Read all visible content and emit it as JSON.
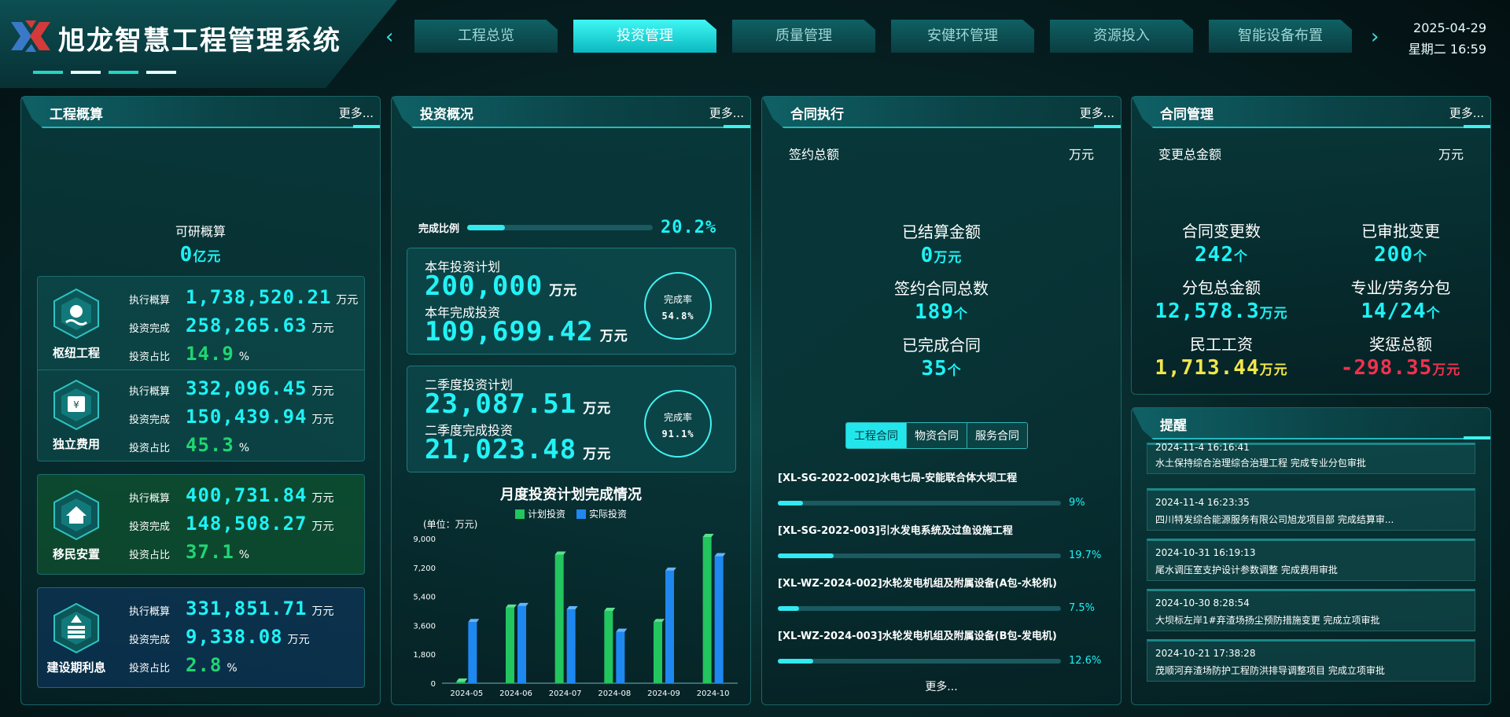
{
  "header": {
    "title": "旭龙智慧工程管理系统",
    "date": "2025-04-29",
    "weekday_time": "星期二  16:59",
    "tabs": [
      {
        "label": "工程总览",
        "active": false
      },
      {
        "label": "投资管理",
        "active": true
      },
      {
        "label": "质量管理",
        "active": false
      },
      {
        "label": "安健环管理",
        "active": false
      },
      {
        "label": "资源投入",
        "active": false
      },
      {
        "label": "智能设备布置",
        "active": false
      }
    ],
    "prev_icon": "chevron-left-icon",
    "next_icon": "chevron-right-icon"
  },
  "budget": {
    "title": "工程概算",
    "more": "更多...",
    "feasibility_label": "可研概算",
    "feasibility_value": "0",
    "feasibility_unit": "亿元",
    "k_exec": "执行概算",
    "k_done": "投资完成",
    "k_ratio": "投资占比",
    "items": [
      {
        "name": "枢纽工程",
        "icon": "dam-icon",
        "exec": "1,738,520.21",
        "exec_unit": "万元",
        "done": "258,265.63",
        "done_unit": "万元",
        "ratio": "14.9",
        "ratio_unit": "%"
      },
      {
        "name": "独立费用",
        "icon": "wallet-icon",
        "exec": "332,096.45",
        "exec_unit": "万元",
        "done": "150,439.94",
        "done_unit": "万元",
        "ratio": "45.3",
        "ratio_unit": "%"
      },
      {
        "name": "移民安置",
        "icon": "house-icon",
        "exec": "400,731.84",
        "exec_unit": "万元",
        "done": "148,508.27",
        "done_unit": "万元",
        "ratio": "37.1",
        "ratio_unit": "%"
      },
      {
        "name": "建设期利息",
        "icon": "coins-icon",
        "exec": "331,851.71",
        "exec_unit": "万元",
        "done": "9,338.08",
        "done_unit": "万元",
        "ratio": "2.8",
        "ratio_unit": "%"
      }
    ]
  },
  "investment": {
    "title": "投资概况",
    "more": "更多...",
    "progress_label": "完成比例",
    "progress_value": "20.2%",
    "progress_fraction": 0.202,
    "year": {
      "plan_label": "本年投资计划",
      "plan_value": "200,000",
      "done_label": "本年完成投资",
      "done_value": "109,699.42",
      "unit": "万元",
      "rate_label": "完成率",
      "rate_value": "54.8%"
    },
    "quarter": {
      "plan_label": "二季度投资计划",
      "plan_value": "23,087.51",
      "done_label": "二季度完成投资",
      "done_value": "21,023.48",
      "unit": "万元",
      "rate_label": "完成率",
      "rate_value": "91.1%"
    }
  },
  "chart_data": {
    "type": "bar",
    "title": "月度投资计划完成情况",
    "unit_label": "(单位：万元)",
    "categories": [
      "2024-05",
      "2024-06",
      "2024-07",
      "2024-08",
      "2024-09",
      "2024-10"
    ],
    "series": [
      {
        "name": "计划投资",
        "color": "#22c55e",
        "values": [
          0,
          4700,
          8000,
          4500,
          3800,
          9100
        ]
      },
      {
        "name": "实际投资",
        "color": "#1e88f0",
        "values": [
          3800,
          4800,
          4600,
          3200,
          7000,
          7900
        ]
      }
    ],
    "yticks": [
      "0",
      "1,800",
      "3,600",
      "5,400",
      "7,200",
      "9,000"
    ],
    "ylim": [
      0,
      9000
    ]
  },
  "contract_exec": {
    "title": "合同执行",
    "more": "更多...",
    "signed_label": "签约总额",
    "signed_unit": "万元",
    "settled_label": "已结算金额",
    "settled_value": "0",
    "settled_unit": "万元",
    "count_label": "签约合同总数",
    "count_value": "189",
    "count_unit": "个",
    "completed_label": "已完成合同",
    "completed_value": "35",
    "completed_unit": "个",
    "tabs": [
      "工程合同",
      "物资合同",
      "服务合同"
    ],
    "contracts": [
      {
        "name": "[XL-SG-2022-002]水电七局-安能联合体大坝工程",
        "pct": "9%",
        "fraction": 0.09
      },
      {
        "name": "[XL-SG-2022-003]引水发电系统及过鱼设施工程",
        "pct": "19.7%",
        "fraction": 0.197
      },
      {
        "name": "[XL-WZ-2024-002]水轮发电机组及附属设备(A包-水轮机)",
        "pct": "7.5%",
        "fraction": 0.075
      },
      {
        "name": "[XL-WZ-2024-003]水轮发电机组及附属设备(B包-发电机)",
        "pct": "12.6%",
        "fraction": 0.126
      }
    ],
    "bottom_more": "更多..."
  },
  "contract_mgmt": {
    "title": "合同管理",
    "more": "更多...",
    "change_label": "变更总金额",
    "change_unit": "万元",
    "cells": [
      {
        "label": "合同变更数",
        "value": "242",
        "unit": "个",
        "color": "cyan"
      },
      {
        "label": "已审批变更",
        "value": "200",
        "unit": "个",
        "color": "cyan"
      },
      {
        "label": "分包总金额",
        "value": "12,578.3",
        "unit": "万元",
        "color": "cyan"
      },
      {
        "label": "专业/劳务分包",
        "value": "14/24",
        "unit": "个",
        "color": "cyan"
      },
      {
        "label": "民工工资",
        "value": "1,713.44",
        "unit": "万元",
        "color": "yellow"
      },
      {
        "label": "奖惩总额",
        "value": "-298.35",
        "unit": "万元",
        "color": "red"
      }
    ]
  },
  "reminders": {
    "title": "提醒",
    "items": [
      {
        "time": "2024-11-4 16:16:41",
        "text": "水土保持综合治理综合治理工程 完成专业分包审批"
      },
      {
        "time": "2024-11-4 16:23:35",
        "text": "四川特发综合能源服务有限公司旭龙项目部 完成结算审..."
      },
      {
        "time": "2024-10-31 16:19:13",
        "text": "尾水调压室支护设计参数调整 完成费用审批"
      },
      {
        "time": "2024-10-30 8:28:54",
        "text": "大坝标左岸1#弃渣场扬尘预防措施变更 完成立项审批"
      },
      {
        "time": "2024-10-21 17:38:28",
        "text": "茂顺河弃渣场防护工程防洪排导调整项目 完成立项审批"
      }
    ]
  }
}
